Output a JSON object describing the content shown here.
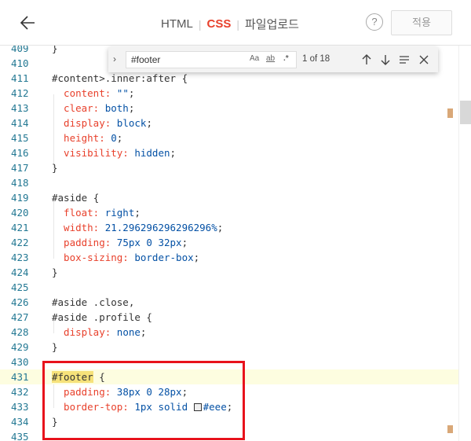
{
  "header": {
    "tabs": [
      {
        "label": "HTML",
        "active": false
      },
      {
        "label": "CSS",
        "active": true
      },
      {
        "label": "파일업로드",
        "active": false
      }
    ],
    "help_label": "?",
    "apply_label": "적용"
  },
  "find": {
    "query": "#footer",
    "match_case_label": "Aa",
    "whole_word_label": "ab",
    "regex_label": ".*",
    "count": "1 of 18"
  },
  "colors": {
    "accent": "#e8412c",
    "line_number": "#237893",
    "value": "#0451a5",
    "highlight_box": "#e8121c",
    "current_line": "#fdfde0"
  },
  "editor": {
    "lines": [
      {
        "n": "409",
        "parts": [
          {
            "t": "punct",
            "v": "}"
          }
        ]
      },
      {
        "n": "410",
        "parts": []
      },
      {
        "n": "411",
        "parts": [
          {
            "t": "sel",
            "v": "#content>.inner:after "
          },
          {
            "t": "punct",
            "v": "{"
          }
        ]
      },
      {
        "n": "412",
        "parts": [
          {
            "t": "prop",
            "v": "  content: "
          },
          {
            "t": "val",
            "v": "\"\""
          },
          {
            "t": "punct",
            "v": ";"
          }
        ]
      },
      {
        "n": "413",
        "parts": [
          {
            "t": "prop",
            "v": "  clear: "
          },
          {
            "t": "val",
            "v": "both"
          },
          {
            "t": "punct",
            "v": ";"
          }
        ]
      },
      {
        "n": "414",
        "parts": [
          {
            "t": "prop",
            "v": "  display: "
          },
          {
            "t": "val",
            "v": "block"
          },
          {
            "t": "punct",
            "v": ";"
          }
        ]
      },
      {
        "n": "415",
        "parts": [
          {
            "t": "prop",
            "v": "  height: "
          },
          {
            "t": "val",
            "v": "0"
          },
          {
            "t": "punct",
            "v": ";"
          }
        ]
      },
      {
        "n": "416",
        "parts": [
          {
            "t": "prop",
            "v": "  visibility: "
          },
          {
            "t": "val",
            "v": "hidden"
          },
          {
            "t": "punct",
            "v": ";"
          }
        ]
      },
      {
        "n": "417",
        "parts": [
          {
            "t": "punct",
            "v": "}"
          }
        ]
      },
      {
        "n": "418",
        "parts": []
      },
      {
        "n": "419",
        "parts": [
          {
            "t": "sel",
            "v": "#aside "
          },
          {
            "t": "punct",
            "v": "{"
          }
        ]
      },
      {
        "n": "420",
        "parts": [
          {
            "t": "prop",
            "v": "  float: "
          },
          {
            "t": "val",
            "v": "right"
          },
          {
            "t": "punct",
            "v": ";"
          }
        ]
      },
      {
        "n": "421",
        "parts": [
          {
            "t": "prop",
            "v": "  width: "
          },
          {
            "t": "val",
            "v": "21.296296296296296%"
          },
          {
            "t": "punct",
            "v": ";"
          }
        ]
      },
      {
        "n": "422",
        "parts": [
          {
            "t": "prop",
            "v": "  padding: "
          },
          {
            "t": "val",
            "v": "75px 0 32px"
          },
          {
            "t": "punct",
            "v": ";"
          }
        ]
      },
      {
        "n": "423",
        "parts": [
          {
            "t": "prop",
            "v": "  box-sizing: "
          },
          {
            "t": "val",
            "v": "border-box"
          },
          {
            "t": "punct",
            "v": ";"
          }
        ]
      },
      {
        "n": "424",
        "parts": [
          {
            "t": "punct",
            "v": "}"
          }
        ]
      },
      {
        "n": "425",
        "parts": []
      },
      {
        "n": "426",
        "parts": [
          {
            "t": "sel",
            "v": "#aside .close"
          },
          {
            "t": "punct",
            "v": ","
          }
        ]
      },
      {
        "n": "427",
        "parts": [
          {
            "t": "sel",
            "v": "#aside .profile "
          },
          {
            "t": "punct",
            "v": "{"
          }
        ]
      },
      {
        "n": "428",
        "parts": [
          {
            "t": "prop",
            "v": "  display: "
          },
          {
            "t": "val",
            "v": "none"
          },
          {
            "t": "punct",
            "v": ";"
          }
        ]
      },
      {
        "n": "429",
        "parts": [
          {
            "t": "punct",
            "v": "}"
          }
        ]
      },
      {
        "n": "430",
        "parts": []
      },
      {
        "n": "431",
        "current": true,
        "parts": [
          {
            "t": "match",
            "v": "#footer"
          },
          {
            "t": "sel",
            "v": " "
          },
          {
            "t": "punct",
            "v": "{"
          }
        ]
      },
      {
        "n": "432",
        "parts": [
          {
            "t": "prop",
            "v": "  padding: "
          },
          {
            "t": "val",
            "v": "38px 0 28px"
          },
          {
            "t": "punct",
            "v": ";"
          }
        ]
      },
      {
        "n": "433",
        "parts": [
          {
            "t": "prop",
            "v": "  border-top: "
          },
          {
            "t": "val",
            "v": "1px solid "
          },
          {
            "t": "swatch",
            "v": ""
          },
          {
            "t": "val",
            "v": "#eee"
          },
          {
            "t": "punct",
            "v": ";"
          }
        ]
      },
      {
        "n": "434",
        "parts": [
          {
            "t": "punct",
            "v": "}"
          }
        ]
      },
      {
        "n": "435",
        "parts": []
      }
    ]
  }
}
